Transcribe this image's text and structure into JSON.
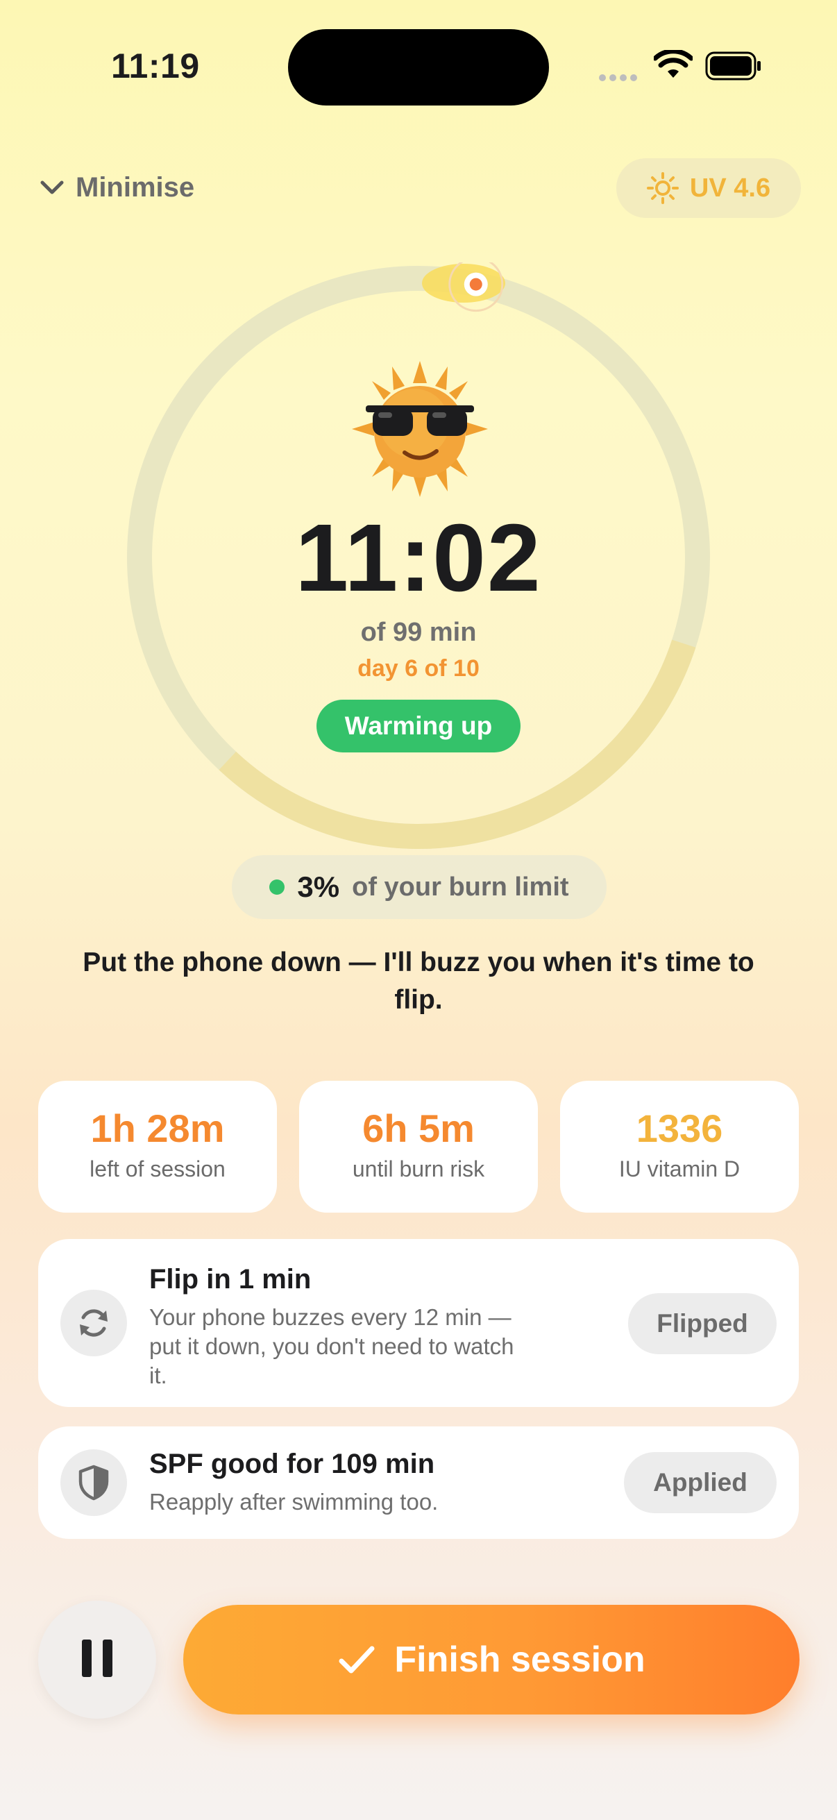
{
  "status_bar": {
    "time": "11:19"
  },
  "header": {
    "minimise_label": "Minimise",
    "uv_label": "UV 4.6"
  },
  "timer": {
    "elapsed": "11:02",
    "of_total": "of 99 min",
    "day": "day 6 of 10",
    "status": "Warming up",
    "progress": 0.11,
    "burn_risk_arc_start": 0.62
  },
  "burn": {
    "percent": "3%",
    "label": "of your burn limit"
  },
  "hint": "Put the phone down — I'll buzz you when it's time to flip.",
  "stats": [
    {
      "value": "1h 28m",
      "label": "left of session",
      "color": "#f5892f"
    },
    {
      "value": "6h 5m",
      "label": "until burn risk",
      "color": "#f5892f"
    },
    {
      "value": "1336",
      "label": "IU vitamin D",
      "color": "#f3b33c"
    }
  ],
  "flip_card": {
    "title": "Flip in 1 min",
    "subtitle_lines": [
      "Your phone buzzes every 12 min —",
      "put it down, you don't need to watch",
      "it."
    ],
    "button": "Flipped",
    "icon": "refresh-icon"
  },
  "spf_card": {
    "title": "SPF good for 109 min",
    "subtitle": "Reapply after swimming too.",
    "button": "Applied",
    "icon": "shield-icon"
  },
  "actions": {
    "finish_label": "Finish session",
    "pause_icon": "pause-icon"
  },
  "colors": {
    "accent_orange": "#ff8f2e",
    "green": "#34c26a",
    "uv_yellow": "#f1b43a"
  }
}
